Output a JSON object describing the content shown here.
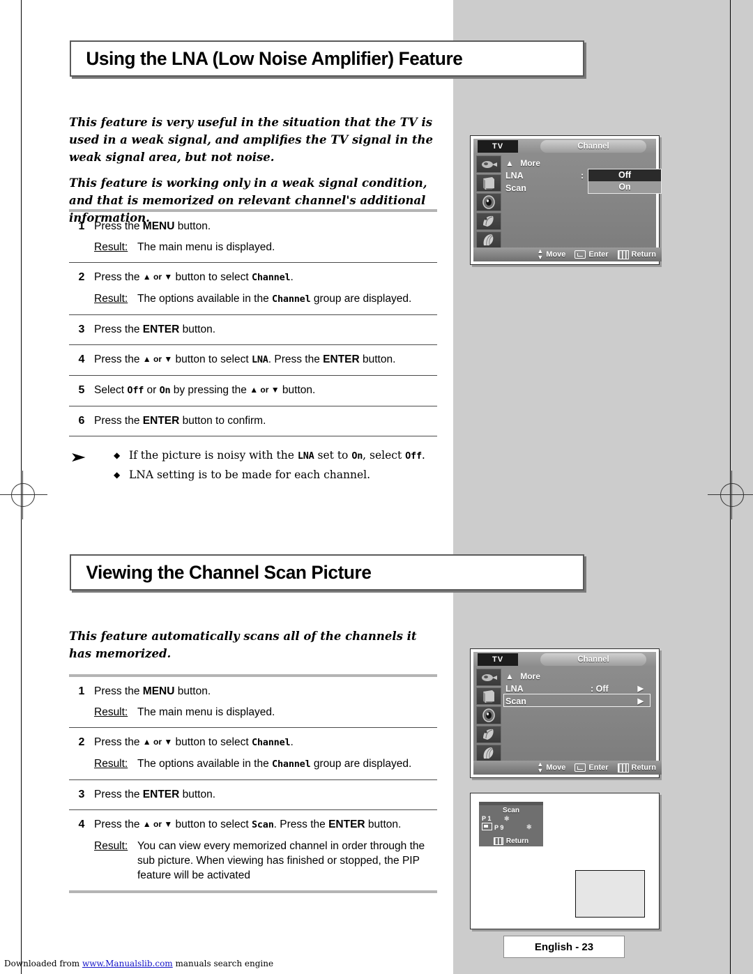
{
  "page": {
    "footer_page_label": "English - 23",
    "download_prefix": "Downloaded from ",
    "download_link": "www.Manualslib.com",
    "download_suffix": " manuals search engine"
  },
  "section1": {
    "heading": "Using the LNA (Low Noise Amplifier) Feature",
    "intro": [
      "This feature is very useful in the situation that the TV is used in a weak signal, and amplifies the TV signal in the weak signal area, but not noise.",
      "This feature is working only in a weak signal condition, and that is memorized on relevant channel's additional information."
    ],
    "steps": [
      {
        "num": "1",
        "action_pre": "Press the ",
        "action_kb": "MENU",
        "action_post": " button.",
        "result_label": "Result:",
        "result_text": "The main menu is displayed."
      },
      {
        "num": "2",
        "action_pre": "Press the ",
        "action_kb": "▲ or ▼",
        "action_post": " button to select ",
        "action_mono": "Channel",
        "action_end": ".",
        "result_label": "Result:",
        "result_pre": "The options available in the ",
        "result_mono": "Channel",
        "result_post": " group are displayed."
      },
      {
        "num": "3",
        "action_pre": "Press the ",
        "action_kb": "ENTER",
        "action_post": " button."
      },
      {
        "num": "4",
        "action_pre": "Press the ",
        "action_kb": "▲ or ▼",
        "action_post": " button to select ",
        "action_mono": "LNA",
        "action_end": ". Press the ",
        "action_kb2": "ENTER",
        "action_tail": " button."
      },
      {
        "num": "5",
        "action_pre": "Select ",
        "action_mono": "Off",
        "action_mid": " or ",
        "action_mono2": "On",
        "action_post": "  by pressing the ",
        "action_kb": "▲ or ▼",
        "action_end": " button."
      },
      {
        "num": "6",
        "action_pre": "Press the ",
        "action_kb": "ENTER",
        "action_post": " button to confirm."
      }
    ],
    "notes": {
      "hand_icon": "pointing-hand-icon",
      "items": [
        {
          "pre": "If the picture is noisy with the ",
          "mono1": "LNA",
          "mid": " set to ",
          "mono2": "On",
          "post": ", select ",
          "mono3": "Off",
          "end": "."
        },
        {
          "pre": "LNA setting is to be made for each channel.",
          "mono1": "",
          "mid": "",
          "mono2": "",
          "post": "",
          "mono3": "",
          "end": ""
        }
      ]
    }
  },
  "section2": {
    "heading": "Viewing the Channel Scan Picture",
    "intro": [
      "This feature automatically scans all of the channels it has memorized."
    ],
    "steps": [
      {
        "num": "1",
        "action_pre": "Press the ",
        "action_kb": "MENU",
        "action_post": " button.",
        "result_label": "Result:",
        "result_text": "The main menu is displayed."
      },
      {
        "num": "2",
        "action_pre": "Press the ",
        "action_kb": "▲ or ▼",
        "action_post": " button to select ",
        "action_mono": "Channel",
        "action_end": ".",
        "result_label": "Result:",
        "result_pre": "The options available in the ",
        "result_mono": "Channel",
        "result_post": " group are displayed."
      },
      {
        "num": "3",
        "action_pre": "Press the ",
        "action_kb": "ENTER",
        "action_post": " button."
      },
      {
        "num": "4",
        "action_pre": "Press the ",
        "action_kb": "▲ or ▼",
        "action_post": " button to select ",
        "action_mono": "Scan",
        "action_end": ". Press the ",
        "action_kb2": "ENTER",
        "action_tail": " button.",
        "result_label": "Result:",
        "result_text": "You can view every memorized channel in order through the sub picture. When viewing has finished or stopped, the PIP feature will be activated"
      }
    ]
  },
  "osd1": {
    "source_label": "TV",
    "tab_label": "Channel",
    "more_label": "More",
    "more_arrow": "▲",
    "rows": [
      {
        "label": "LNA",
        "colon": ":"
      },
      {
        "label": "Scan"
      }
    ],
    "options": [
      {
        "value": "Off",
        "selected": true
      },
      {
        "value": "On",
        "selected": false
      }
    ],
    "footer": [
      {
        "icon": "up-down-arrows-icon",
        "label": "Move"
      },
      {
        "icon": "enter-key-icon",
        "label": "Enter"
      },
      {
        "icon": "return-key-icon",
        "label": "Return"
      }
    ],
    "side_icons": [
      "input-source-icon",
      "picture-icon",
      "sound-icon",
      "setup-icon",
      "pip-icon"
    ]
  },
  "osd2": {
    "source_label": "TV",
    "tab_label": "Channel",
    "more_label": "More",
    "more_arrow": "▲",
    "rows": [
      {
        "label": "LNA",
        "value": ": Off",
        "arrow": "▶",
        "highlighted": false
      },
      {
        "label": "Scan",
        "value": "",
        "arrow": "▶",
        "highlighted": true
      }
    ],
    "footer": [
      {
        "icon": "up-down-arrows-icon",
        "label": "Move"
      },
      {
        "icon": "enter-key-icon",
        "label": "Enter"
      },
      {
        "icon": "return-key-icon",
        "label": "Return"
      }
    ],
    "side_icons": [
      "input-source-icon",
      "picture-icon",
      "sound-icon",
      "setup-icon",
      "pip-icon"
    ]
  },
  "scan_picture": {
    "title": "Scan",
    "line1": "P  1",
    "line1_star": "✱",
    "line2": "P  9",
    "line2_star": "✱",
    "return_label": "Return",
    "return_icon": "return-key-icon",
    "pip_icon": "pip-icon"
  }
}
